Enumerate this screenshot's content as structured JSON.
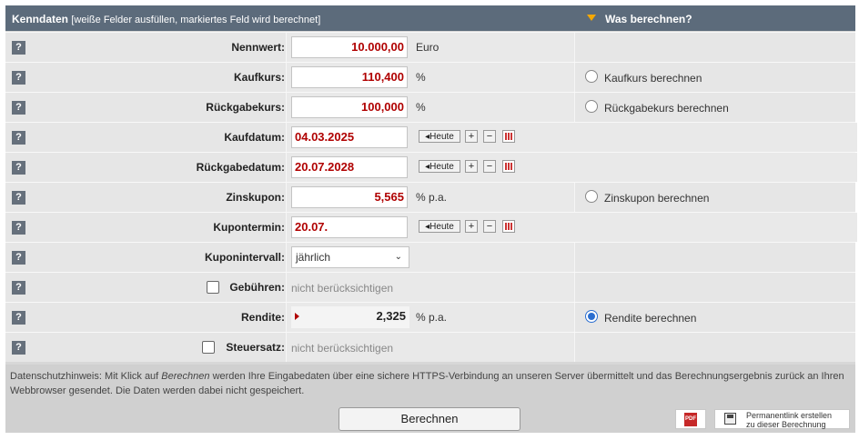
{
  "header": {
    "title": "Kenndaten",
    "note": "[weiße Felder ausfüllen, markiertes Feld wird berechnet]",
    "right_title": "Was berechnen?"
  },
  "help_label": "?",
  "rows": {
    "nennwert": {
      "label": "Nennwert:",
      "value": "10.000,00",
      "unit": "Euro"
    },
    "kaufkurs": {
      "label": "Kaufkurs:",
      "value": "110,400",
      "unit": "%",
      "radio_label": "Kaufkurs berechnen",
      "selected": false
    },
    "rueckgabekurs": {
      "label": "Rückgabekurs:",
      "value": "100,000",
      "unit": "%",
      "radio_label": "Rückgabekurs berechnen",
      "selected": false
    },
    "kaufdatum": {
      "label": "Kaufdatum:",
      "value": "04.03.2025"
    },
    "rueckgabedatum": {
      "label": "Rückgabedatum:",
      "value": "20.07.2028"
    },
    "zinskupon": {
      "label": "Zinskupon:",
      "value": "5,565",
      "unit": "% p.a.",
      "radio_label": "Zinskupon berechnen",
      "selected": false
    },
    "kupontermin": {
      "label": "Kupontermin:",
      "value": "20.07."
    },
    "kuponintervall": {
      "label": "Kuponintervall:",
      "value": "jährlich"
    },
    "gebuehren": {
      "label": "Gebühren:",
      "value": "nicht berücksichtigen",
      "checked": false
    },
    "rendite": {
      "label": "Rendite:",
      "value": "2,325",
      "unit": "% p.a.",
      "radio_label": "Rendite berechnen",
      "selected": true
    },
    "steuersatz": {
      "label": "Steuersatz:",
      "value": "nicht berücksichtigen",
      "checked": false
    }
  },
  "date_controls": {
    "today": "Heute",
    "plus": "+",
    "minus": "−"
  },
  "footer": {
    "note_prefix": "Datenschutzhinweis: Mit Klick auf ",
    "note_emph": "Berechnen",
    "note_suffix": " werden Ihre Eingabedaten über eine sichere HTTPS-Verbindung an unseren Server übermittelt und das Berechnungsergebnis zurück an Ihren Webbrowser gesendet. Die Daten werden dabei nicht gespeichert.",
    "calc_button": "Berechnen",
    "pdf_icon": "PDF",
    "permalink_line1": "Permanentlink erstellen",
    "permalink_line2": "zu dieser Berechnung"
  },
  "colors": {
    "header_bg": "#5c6b7b",
    "accent": "#f6a800",
    "input_text": "#b00000",
    "radio_on": "#2b6ed0"
  }
}
